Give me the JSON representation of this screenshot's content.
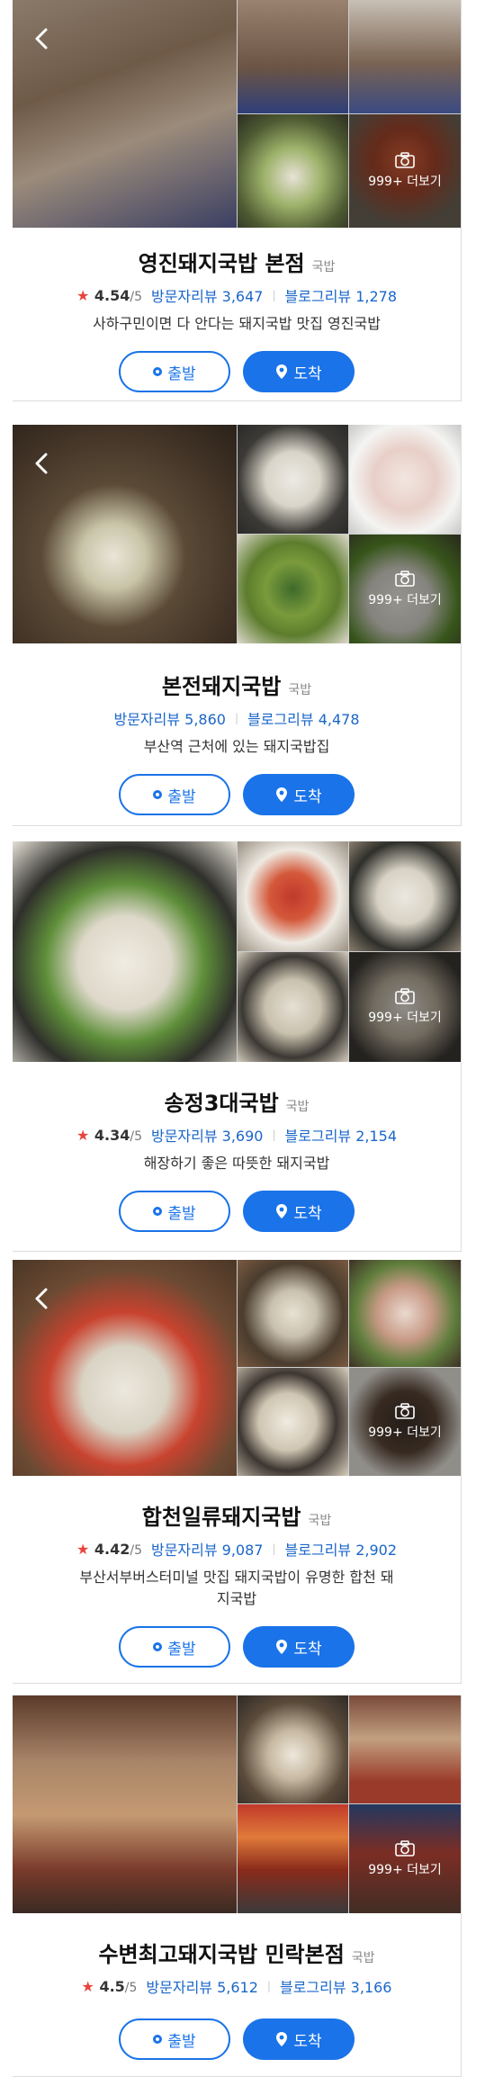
{
  "places": [
    {
      "name": "영진돼지국밥 본점",
      "category": "국밥",
      "rating": "4.54",
      "rating_max": "/5",
      "visitor_reviews": "방문자리뷰 3,647",
      "blog_reviews": "블로그리뷰 1,278",
      "description": "사하구민이면 다 안다는 돼지국밥 맛집 영진국밥",
      "photo_more": "999+ 더보기",
      "start_label": "출발",
      "arrive_label": "도착"
    },
    {
      "name": "본전돼지국밥",
      "category": "국밥",
      "visitor_reviews": "방문자리뷰 5,860",
      "blog_reviews": "블로그리뷰 4,478",
      "description": "부산역 근처에 있는 돼지국밥집",
      "photo_more": "999+ 더보기",
      "start_label": "출발",
      "arrive_label": "도착"
    },
    {
      "name": "송정3대국밥",
      "category": "국밥",
      "rating": "4.34",
      "rating_max": "/5",
      "visitor_reviews": "방문자리뷰 3,690",
      "blog_reviews": "블로그리뷰 2,154",
      "description": "해장하기 좋은 따뜻한 돼지국밥",
      "photo_more": "999+ 더보기",
      "start_label": "출발",
      "arrive_label": "도착"
    },
    {
      "name": "합천일류돼지국밥",
      "category": "국밥",
      "rating": "4.42",
      "rating_max": "/5",
      "visitor_reviews": "방문자리뷰 9,087",
      "blog_reviews": "블로그리뷰 2,902",
      "description": "부산서부버스터미널 맛집 돼지국밥이 유명한 합천 돼지국밥",
      "photo_more": "999+ 더보기",
      "start_label": "출발",
      "arrive_label": "도착"
    },
    {
      "name": "수변최고돼지국밥 민락본점",
      "category": "국밥",
      "rating": "4.5",
      "rating_max": "/5",
      "visitor_reviews": "방문자리뷰 5,612",
      "blog_reviews": "블로그리뷰 3,166",
      "description": "",
      "photo_more": "999+ 더보기",
      "start_label": "출발",
      "arrive_label": "도착"
    }
  ],
  "icons": {
    "back": "chevron-left-icon",
    "camera": "camera-icon",
    "star": "star-icon",
    "start": "circle-dot-icon",
    "arrive": "map-pin-icon"
  },
  "colors": {
    "accent": "#1a73e8",
    "review_link": "#1a66c9",
    "star": "#e8433d"
  }
}
